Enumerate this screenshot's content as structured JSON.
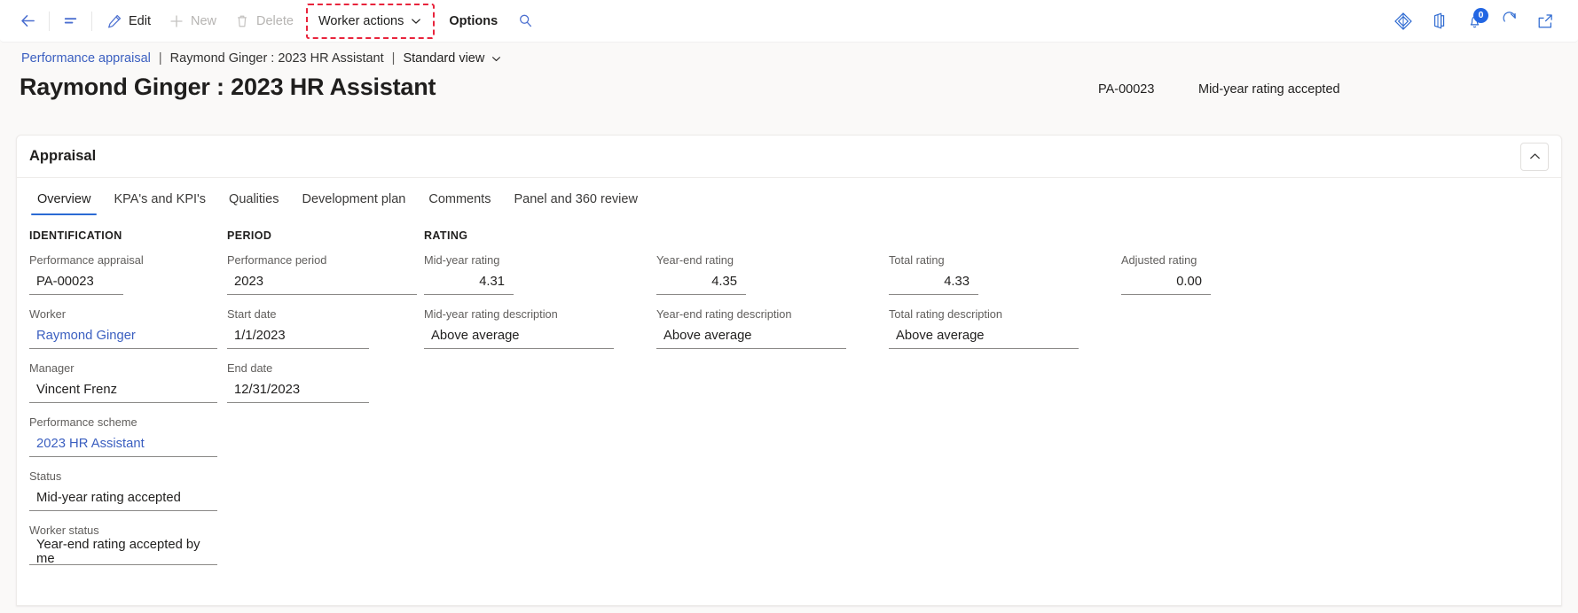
{
  "commandbar": {
    "back_label": "back-arrow",
    "nav_label": "show-navigation",
    "buttons": [
      {
        "label": "Edit",
        "icon": "pencil-icon",
        "state": "enabled"
      },
      {
        "label": "New",
        "icon": "plus-icon",
        "state": "disabled"
      },
      {
        "label": "Delete",
        "icon": "trash-icon",
        "state": "disabled"
      }
    ],
    "worker_actions": {
      "label": "Worker actions",
      "highlighted": true,
      "highlight_color": "#e8243c"
    },
    "options": "Options",
    "search_icon": "search-icon",
    "right_icons": [
      {
        "name": "dynamics-diamond-icon"
      },
      {
        "name": "office-app-icon"
      },
      {
        "name": "notifications-bell-icon",
        "badge": "0"
      },
      {
        "name": "refresh-icon"
      },
      {
        "name": "open-in-new-window-icon"
      }
    ]
  },
  "breadcrumb": {
    "module": "Performance appraisal",
    "sep1": "|",
    "record": "Raymond Ginger : 2023 HR Assistant",
    "sep2": "|",
    "view": "Standard view"
  },
  "header": {
    "title": "Raymond Ginger : 2023 HR Assistant",
    "record_id": "PA-00023",
    "status": "Mid-year rating accepted"
  },
  "card": {
    "title": "Appraisal",
    "collapse_icon": "chevron-up-icon",
    "tabs": [
      {
        "label": "Overview",
        "active": true
      },
      {
        "label": "KPA's and KPI's",
        "active": false
      },
      {
        "label": "Qualities",
        "active": false
      },
      {
        "label": "Development plan",
        "active": false
      },
      {
        "label": "Comments",
        "active": false
      },
      {
        "label": "Panel and 360 review",
        "active": false
      }
    ]
  },
  "identification": {
    "heading": "IDENTIFICATION",
    "fields": [
      {
        "label": "Performance appraisal",
        "value": "PA-00023",
        "style": "text"
      },
      {
        "label": "Worker",
        "value": "Raymond Ginger",
        "style": "link"
      },
      {
        "label": "Manager",
        "value": "Vincent Frenz",
        "style": "text"
      },
      {
        "label": "Performance scheme",
        "value": "2023 HR Assistant",
        "style": "link"
      },
      {
        "label": "Status",
        "value": "Mid-year rating accepted",
        "style": "text"
      },
      {
        "label": "Worker status",
        "value": "Year-end rating accepted by me",
        "style": "text"
      }
    ]
  },
  "period": {
    "heading": "PERIOD",
    "fields": [
      {
        "label": "Performance period",
        "value": "2023",
        "style": "text"
      },
      {
        "label": "Start date",
        "value": "1/1/2023",
        "style": "text"
      },
      {
        "label": "End date",
        "value": "12/31/2023",
        "style": "text"
      }
    ]
  },
  "rating": {
    "heading": "RATING",
    "columns": [
      {
        "rating_label": "Mid-year rating",
        "rating_value": "4.31",
        "desc_label": "Mid-year rating description",
        "desc_value": "Above average"
      },
      {
        "rating_label": "Year-end rating",
        "rating_value": "4.35",
        "desc_label": "Year-end rating description",
        "desc_value": "Above average"
      },
      {
        "rating_label": "Total rating",
        "rating_value": "4.33",
        "desc_label": "Total rating description",
        "desc_value": "Above average"
      },
      {
        "rating_label": "Adjusted rating",
        "rating_value": "0.00",
        "desc_label": "",
        "desc_value": ""
      }
    ]
  }
}
